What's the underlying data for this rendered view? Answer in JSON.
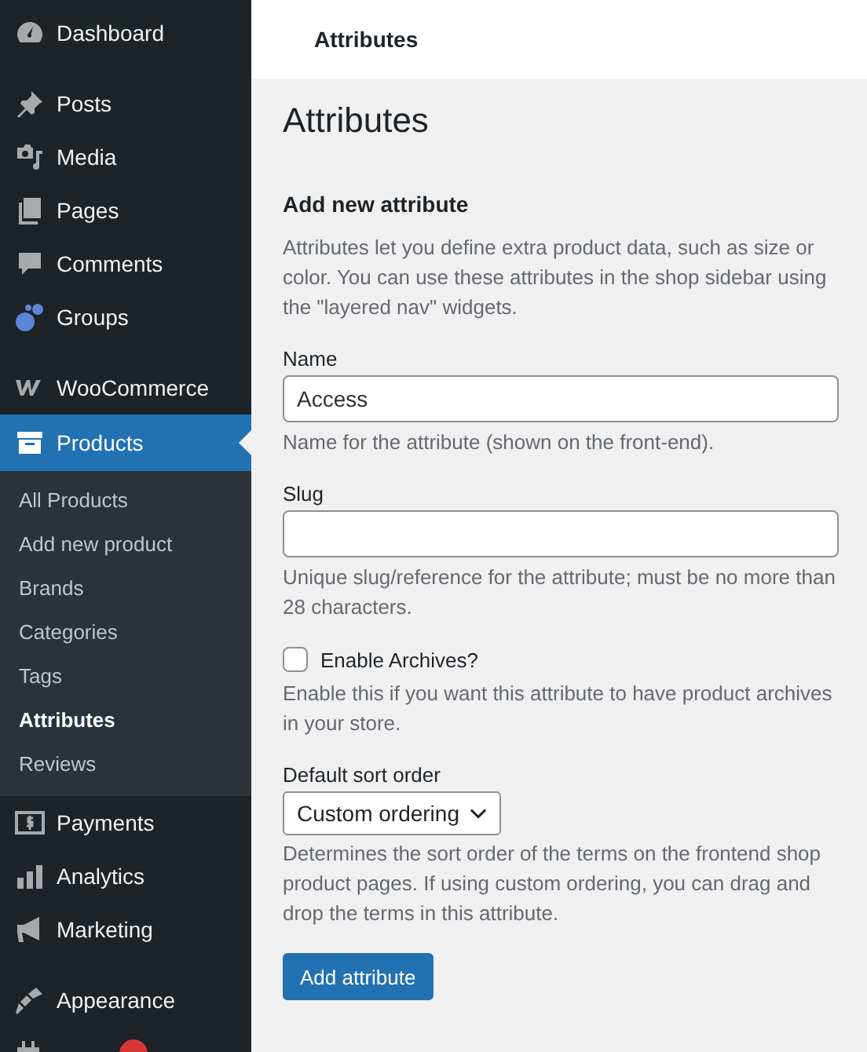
{
  "sidebar": {
    "menu_groups": [
      [
        {
          "label": "Dashboard",
          "selected": false
        }
      ],
      [
        {
          "label": "Posts",
          "selected": false
        },
        {
          "label": "Media",
          "selected": false
        },
        {
          "label": "Pages",
          "selected": false
        },
        {
          "label": "Comments",
          "selected": false
        },
        {
          "label": "Groups",
          "selected": false
        }
      ],
      [
        {
          "label": "WooCommerce",
          "selected": false
        },
        {
          "label": "Products",
          "selected": true,
          "children": [
            {
              "label": "All Products",
              "selected": false
            },
            {
              "label": "Add new product",
              "selected": false
            },
            {
              "label": "Brands",
              "selected": false
            },
            {
              "label": "Categories",
              "selected": false
            },
            {
              "label": "Tags",
              "selected": false
            },
            {
              "label": "Attributes",
              "selected": true
            },
            {
              "label": "Reviews",
              "selected": false
            }
          ]
        },
        {
          "label": "Payments",
          "selected": false
        },
        {
          "label": "Analytics",
          "selected": false
        },
        {
          "label": "Marketing",
          "selected": false
        }
      ],
      [
        {
          "label": "Appearance",
          "selected": false
        },
        {
          "selected": false,
          "has_badge": true
        }
      ]
    ]
  },
  "header": {
    "title": "Attributes"
  },
  "page": {
    "title": "Attributes",
    "form": {
      "title": "Add new attribute",
      "intro": "Attributes let you define extra product data, such as size or color. You can use these attributes in the shop sidebar using the \"layered nav\" widgets.",
      "fields": [
        {
          "kind": "text",
          "label": "Name",
          "value": "Access",
          "help": "Name for the attribute (shown on the front-end)."
        },
        {
          "kind": "text",
          "label": "Slug",
          "help": "Unique slug/reference for the attribute; must be no more than 28 characters."
        },
        {
          "kind": "checkbox",
          "label": "Enable Archives?",
          "checked": false,
          "help": "Enable this if you want this attribute to have product archives in your store."
        },
        {
          "kind": "select",
          "label": "Default sort order",
          "value": "Custom ordering",
          "help": "Determines the sort order of the terms on the frontend shop product pages. If using custom ordering, you can drag and drop the terms in this attribute."
        }
      ],
      "submit": "Add attribute"
    }
  }
}
